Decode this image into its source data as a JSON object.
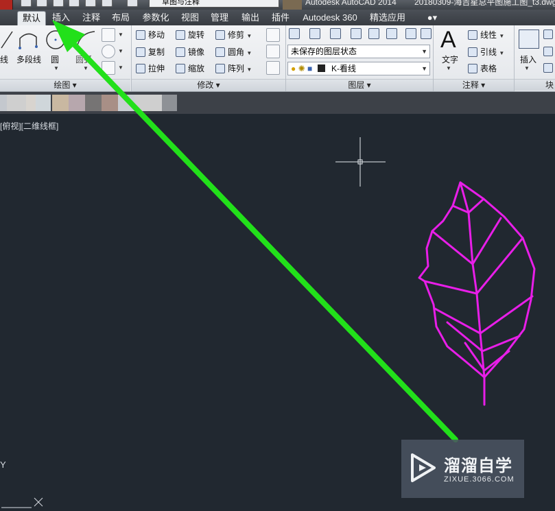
{
  "title_bar": {
    "workspace": "草图与注释",
    "app_title": "Autodesk AutoCAD 2014",
    "file_title": "20180309-海吉星总平图施工图_t3.dwg"
  },
  "tabs": [
    "默认",
    "插入",
    "注释",
    "布局",
    "参数化",
    "视图",
    "管理",
    "输出",
    "插件",
    "Autodesk 360",
    "精选应用"
  ],
  "active_tab": "默认",
  "ribbon": {
    "draw": {
      "title": "绘图",
      "items": [
        "线",
        "多段线",
        "圆",
        "圆弧"
      ]
    },
    "modify": {
      "title": "修改",
      "rows": [
        [
          "移动",
          "旋转",
          "修剪"
        ],
        [
          "复制",
          "镜像",
          "圆角"
        ],
        [
          "拉伸",
          "缩放",
          "阵列"
        ]
      ]
    },
    "layers": {
      "title": "图层",
      "layer_state": "未保存的图层状态",
      "current_layer": "K-看线"
    },
    "annotation": {
      "title": "注释",
      "text_label": "文字",
      "items": [
        "线性",
        "引线",
        "表格"
      ]
    },
    "block": {
      "title": "块",
      "insert_label": "插入"
    }
  },
  "viewport": {
    "label": "[俯视][二维线框]",
    "ucs_y": "Y",
    "ucs_x": "X"
  },
  "colors": {
    "canvas_bg": "#212830",
    "leaf_stroke": "#e81ee8",
    "arrow": "#22e01a",
    "crosshair": "#e8ecf0"
  },
  "watermark": {
    "brand": "溜溜自学",
    "url": "ZIXUE.3066.COM"
  }
}
